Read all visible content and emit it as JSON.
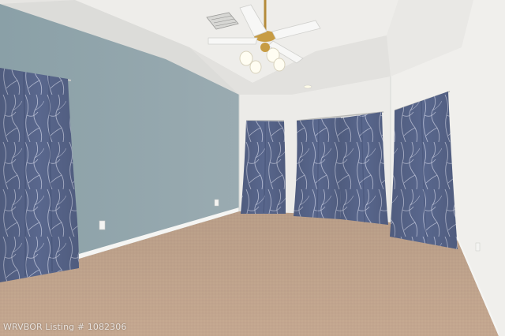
{
  "photo": {
    "subject": "empty-bedroom",
    "watermark": "WRVBOR Listing # 1082306"
  },
  "colors": {
    "accent_wall": "#91a4ab",
    "white_wall": "#ecebe8",
    "ceiling": "#e6e5e2",
    "carpet": "#c4a78f",
    "curtain": "#59678d",
    "curtain_pattern": "#c5cbe0",
    "baseboard": "#f5f5f3"
  }
}
